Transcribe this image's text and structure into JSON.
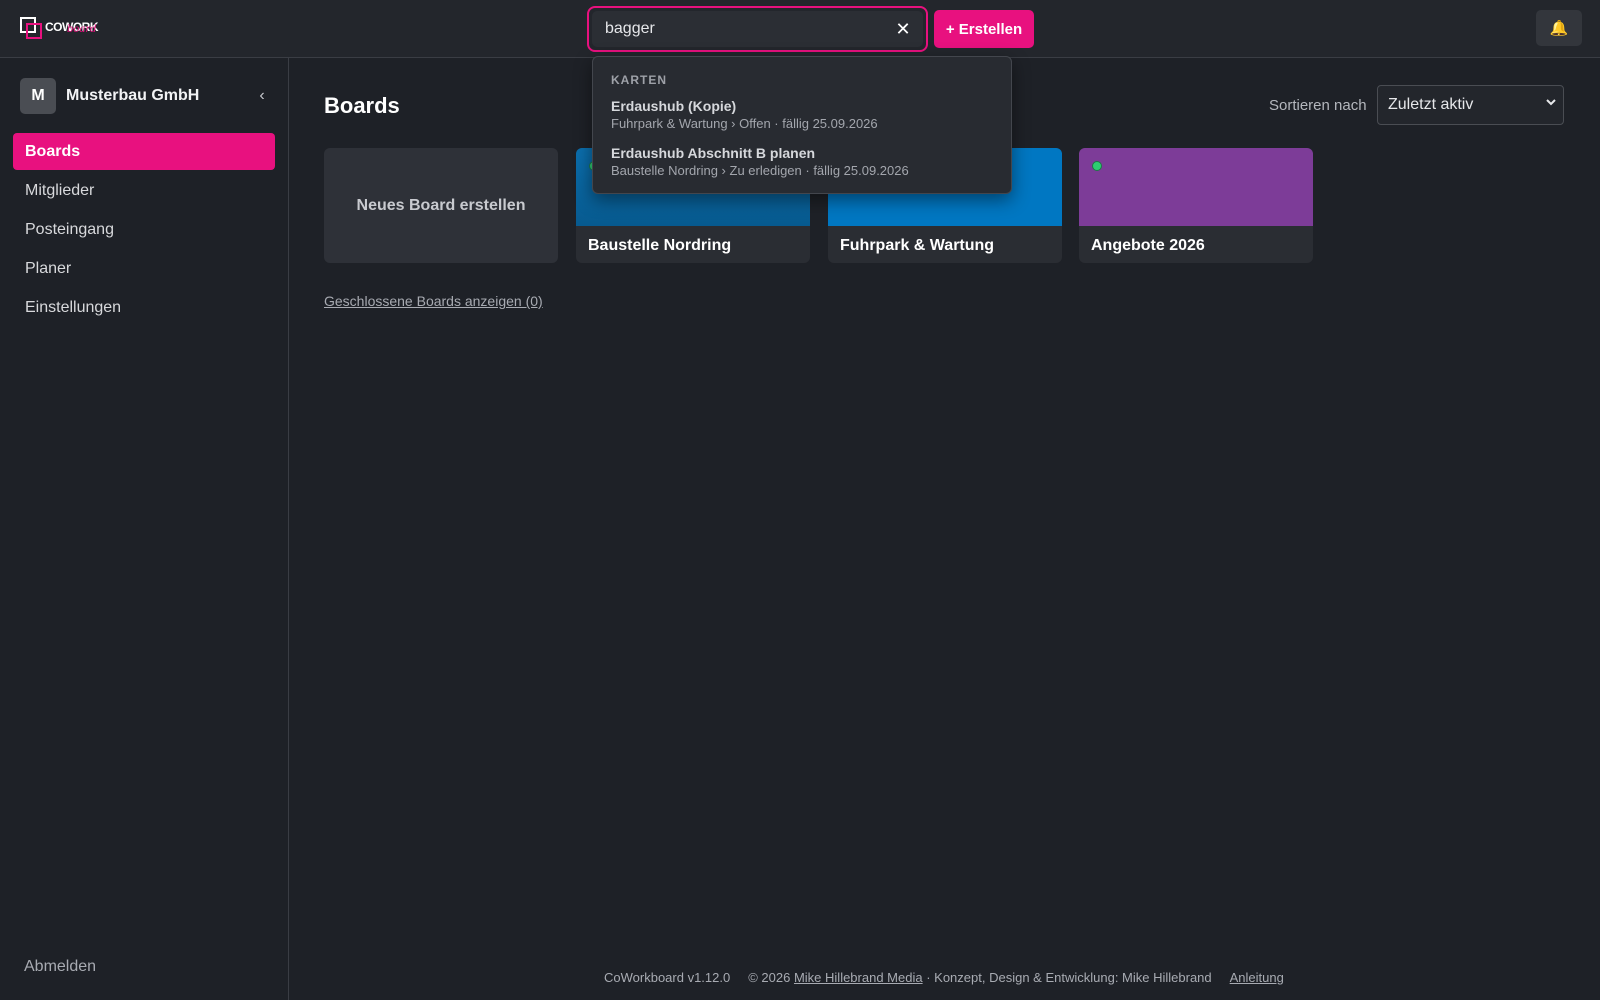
{
  "app": {
    "logo_text": "COWORK",
    "logo_sub": "board"
  },
  "topbar": {
    "search_value": "bagger",
    "clear_glyph": "✕",
    "create_label": "+ Erstellen",
    "bell_glyph": "🔔"
  },
  "sidebar": {
    "org_initial": "M",
    "org_name": "Musterbau GmbH",
    "collapse_glyph": "‹",
    "items": [
      {
        "label": "Boards"
      },
      {
        "label": "Mitglieder"
      },
      {
        "label": "Posteingang"
      },
      {
        "label": "Planer"
      },
      {
        "label": "Einstellungen"
      }
    ],
    "logout_label": "Abmelden"
  },
  "main": {
    "title": "Boards",
    "sort_label": "Sortieren nach",
    "sort_value": "Zuletzt aktiv",
    "new_board_label": "Neues Board erstellen",
    "boards": [
      {
        "title": "Baustelle Nordring",
        "color": "#0b6fae",
        "color2": "#075a8f",
        "active_dot": true
      },
      {
        "title": "Fuhrpark & Wartung",
        "color": "#0077c2",
        "color2": "#0077c2",
        "active_dot": false
      },
      {
        "title": "Angebote 2026",
        "color": "#7d3c98",
        "color2": "#7d3c98",
        "active_dot": true
      }
    ],
    "closed_link": "Geschlossene Boards anzeigen (0)"
  },
  "search_dropdown": {
    "heading": "KARTEN",
    "results": [
      {
        "title": "Erdaushub (Kopie)",
        "meta": "Fuhrpark & Wartung › Offen · fällig 25.09.2026"
      },
      {
        "title": "Erdaushub Abschnitt B planen",
        "meta": "Baustelle Nordring › Zu erledigen · fällig 25.09.2026"
      }
    ]
  },
  "footer": {
    "version": "CoWorkboard v1.12.0",
    "copyright": "© 2026",
    "company_link": "Mike Hillebrand Media",
    "credit": "· Konzept, Design & Entwicklung: Mike Hillebrand",
    "guide_link": "Anleitung"
  },
  "colors": {
    "accent": "#e8117f",
    "background": "#1e2127",
    "status_dot": "#2ecc71"
  }
}
